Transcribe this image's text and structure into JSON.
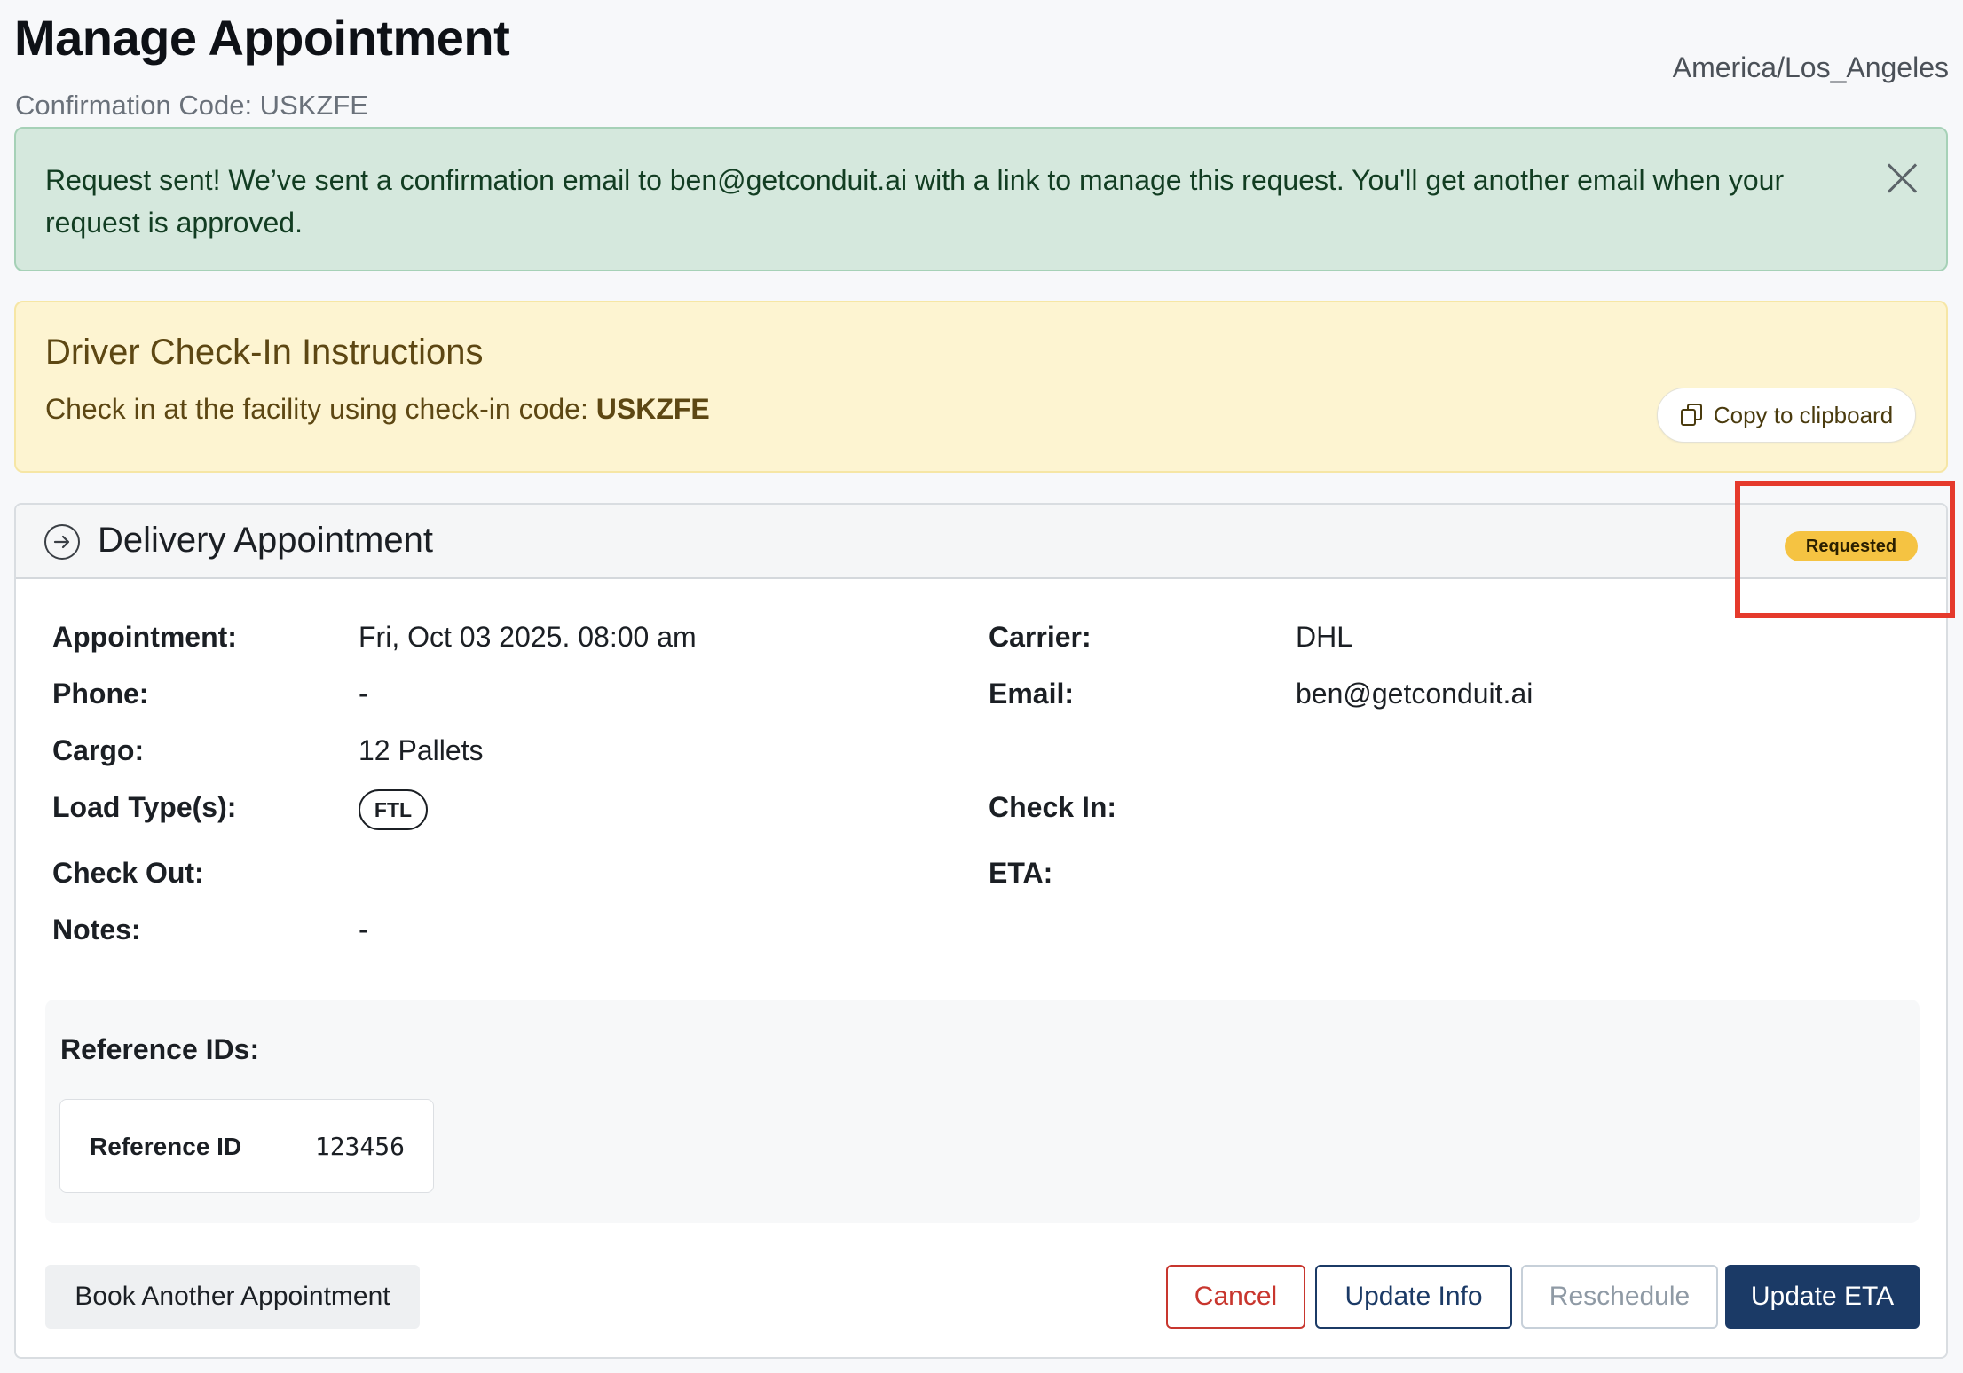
{
  "header": {
    "title": "Manage Appointment",
    "confirmation_code": "Confirmation Code: USKZFE",
    "timezone": "America/Los_Angeles"
  },
  "alert": {
    "message": "Request sent! We’ve sent a confirmation email to ben@getconduit.ai with a link to manage this request. You'll get another email when your request is approved.",
    "close_icon": "close-icon"
  },
  "checkin": {
    "title": "Driver Check-In Instructions",
    "text": "Check in at the facility using check-in code: ",
    "code": "USKZFE",
    "copy_label": "Copy to clipboard"
  },
  "appointment": {
    "title": "Delivery Appointment",
    "status": "Requested",
    "colors": {
      "status_badge": "#f5c342",
      "highlight": "#e53a2c",
      "primary": "#1b3a66"
    },
    "fields": {
      "appointment_label": "Appointment:",
      "appointment_value": "Fri, Oct 03 2025. 08:00 am",
      "carrier_label": "Carrier:",
      "carrier_value": "DHL",
      "phone_label": "Phone:",
      "phone_value": "-",
      "email_label": "Email:",
      "email_value": "ben@getconduit.ai",
      "cargo_label": "Cargo:",
      "cargo_value": "12 Pallets",
      "load_type_label": "Load Type(s):",
      "load_type_value": "FTL",
      "check_in_label": "Check In:",
      "check_out_label": "Check Out:",
      "eta_label": "ETA:",
      "notes_label": "Notes:",
      "notes_value": "-"
    },
    "reference": {
      "title": "Reference IDs:",
      "label": "Reference ID",
      "value": "123456"
    },
    "buttons": {
      "book_another": "Book Another Appointment",
      "cancel": "Cancel",
      "update_info": "Update Info",
      "reschedule": "Reschedule",
      "update_eta": "Update ETA"
    }
  }
}
